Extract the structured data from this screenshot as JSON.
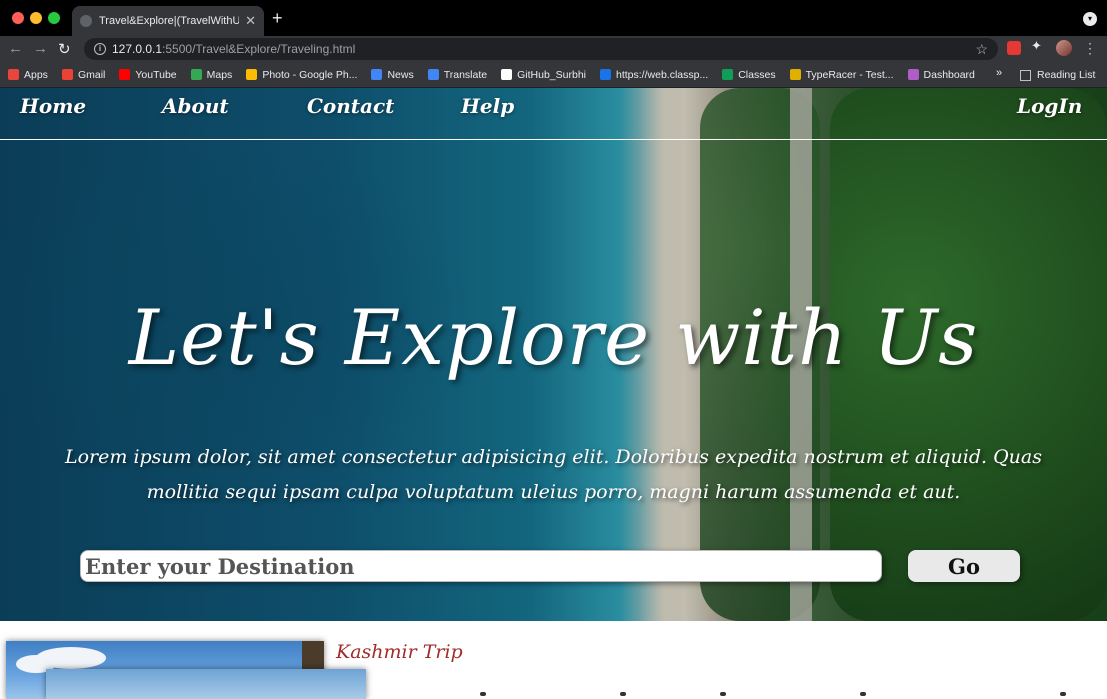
{
  "browser": {
    "tab_title": "Travel&Explore|(TravelWithUs...",
    "tab_close": "✕",
    "new_tab": "+",
    "url_host": "127.0.0.1",
    "url_path": ":5500/Travel&Explore/Traveling.html",
    "bookmarks": [
      {
        "label": "Apps",
        "icon": "apps-grid-icon",
        "color": "#e8453c"
      },
      {
        "label": "Gmail",
        "icon": "gmail-icon",
        "color": "#ea4335"
      },
      {
        "label": "YouTube",
        "icon": "youtube-icon",
        "color": "#ff0000"
      },
      {
        "label": "Maps",
        "icon": "maps-icon",
        "color": "#34a853"
      },
      {
        "label": "Photo - Google Ph...",
        "icon": "photos-icon",
        "color": "#fbbc04"
      },
      {
        "label": "News",
        "icon": "news-icon",
        "color": "#4285f4"
      },
      {
        "label": "Translate",
        "icon": "translate-icon",
        "color": "#4285f4"
      },
      {
        "label": "GitHub_Surbhi",
        "icon": "github-icon",
        "color": "#ffffff"
      },
      {
        "label": "https://web.classp...",
        "icon": "classplus-icon",
        "color": "#1a73e8"
      },
      {
        "label": "Classes",
        "icon": "classroom-icon",
        "color": "#0f9d58"
      },
      {
        "label": "TypeRacer - Test...",
        "icon": "typeracer-icon",
        "color": "#e0b000"
      },
      {
        "label": "Dashboard",
        "icon": "dashboard-icon",
        "color": "#b05cc9"
      }
    ],
    "more_bookmarks": "»",
    "reading_list": "Reading List"
  },
  "nav": {
    "home": "Home",
    "about": "About",
    "contact": "Contact",
    "help": "Help",
    "login": "LogIn"
  },
  "hero": {
    "headline": "Let's Explore with Us",
    "subtext": "Lorem ipsum dolor, sit amet consectetur adipisicing elit. Doloribus expedita nostrum et aliquid. Quas mollitia sequi ipsam culpa voluptatum uleius porro, magni harum assumenda et aut.",
    "search_placeholder": "Enter your Destination",
    "go_label": "Go"
  },
  "trip": {
    "title": "Kashmir Trip"
  },
  "colors": {
    "trip_title": "#a32b2b",
    "nav_text": "#ffffff"
  }
}
